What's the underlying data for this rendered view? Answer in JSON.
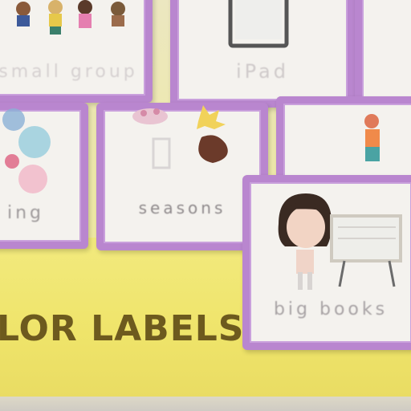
{
  "banner": {
    "text": "LOR LABELS"
  },
  "cards": {
    "small_group": "small group",
    "ipad": "iPad",
    "writing": "ing",
    "seasons": "seasons",
    "big_books": "big books"
  }
}
